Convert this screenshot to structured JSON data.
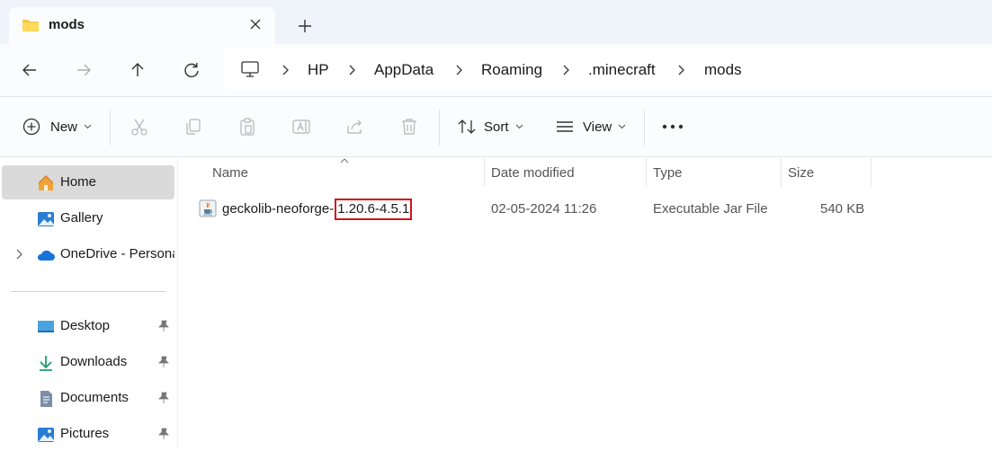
{
  "tab": {
    "title": "mods"
  },
  "breadcrumb": [
    "HP",
    "AppData",
    "Roaming",
    ".minecraft",
    "mods"
  ],
  "toolbar": {
    "new_label": "New",
    "sort_label": "Sort",
    "view_label": "View"
  },
  "sidebar": {
    "items": [
      {
        "label": "Home"
      },
      {
        "label": "Gallery"
      },
      {
        "label": "OneDrive - Personal"
      },
      {
        "label": "Desktop"
      },
      {
        "label": "Downloads"
      },
      {
        "label": "Documents"
      },
      {
        "label": "Pictures"
      }
    ]
  },
  "columns": {
    "name": "Name",
    "date": "Date modified",
    "type": "Type",
    "size": "Size"
  },
  "files": [
    {
      "name_prefix": "geckolib-neoforge-",
      "name_highlight": "1.20.6-4.5.1",
      "date": "02-05-2024 11:26",
      "type": "Executable Jar File",
      "size": "540 KB"
    }
  ],
  "colors": {
    "accent": "#0067c0",
    "highlight_box": "#d0141c",
    "selected_bg": "#dadada"
  }
}
